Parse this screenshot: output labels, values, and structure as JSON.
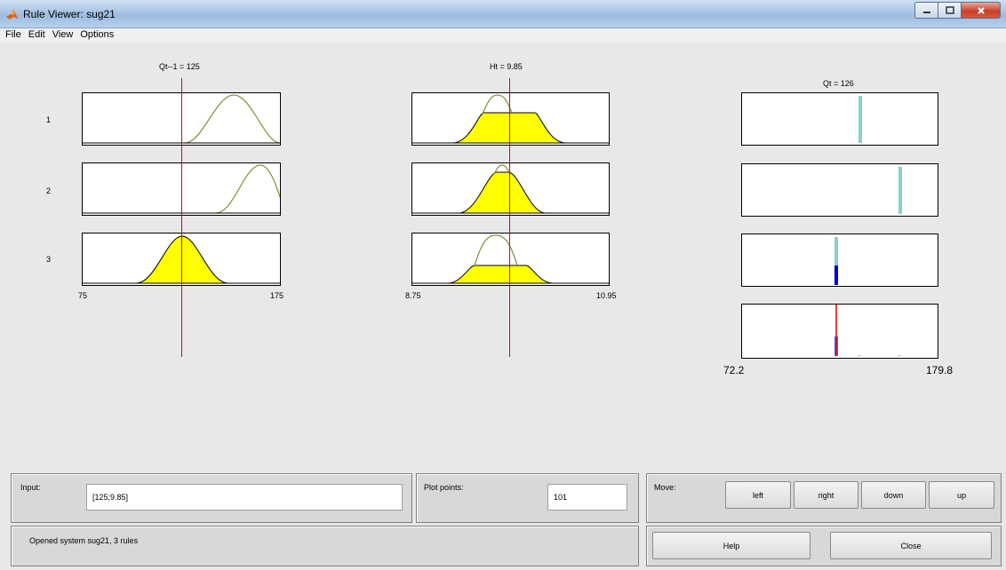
{
  "window": {
    "title": "Rule Viewer: sug21"
  },
  "menu": {
    "items": [
      "File",
      "Edit",
      "View",
      "Options"
    ]
  },
  "inputs": [
    {
      "label": "Qt--1 = 125",
      "range_min": "75",
      "range_max": "175",
      "value": 125,
      "min": 75,
      "max": 175
    },
    {
      "label": "Ht = 9.85",
      "range_min": "8.75",
      "range_max": "10.95",
      "value": 9.85,
      "min": 8.75,
      "max": 10.95
    }
  ],
  "output": {
    "label": "Qt = 126",
    "range_min": "72.2",
    "range_max": "179.8",
    "value": 126
  },
  "rules": [
    {
      "number": "1"
    },
    {
      "number": "2"
    },
    {
      "number": "3"
    }
  ],
  "controls": {
    "input_label": "Input:",
    "input_value": "[125;9.85]",
    "plot_points_label": "Plot points:",
    "plot_points_value": "101",
    "move_label": "Move:",
    "move_buttons": [
      "left",
      "right",
      "down",
      "up"
    ],
    "help_label": "Help",
    "close_label": "Close"
  },
  "status": {
    "message": "Opened system sug21, 3 rules"
  },
  "colors": {
    "mf_line": "#8c8c3c",
    "fill": "#ffff00",
    "indicator": "#e00000",
    "output_stem": "#8ccdd0",
    "output_weight": "#0000e0"
  }
}
